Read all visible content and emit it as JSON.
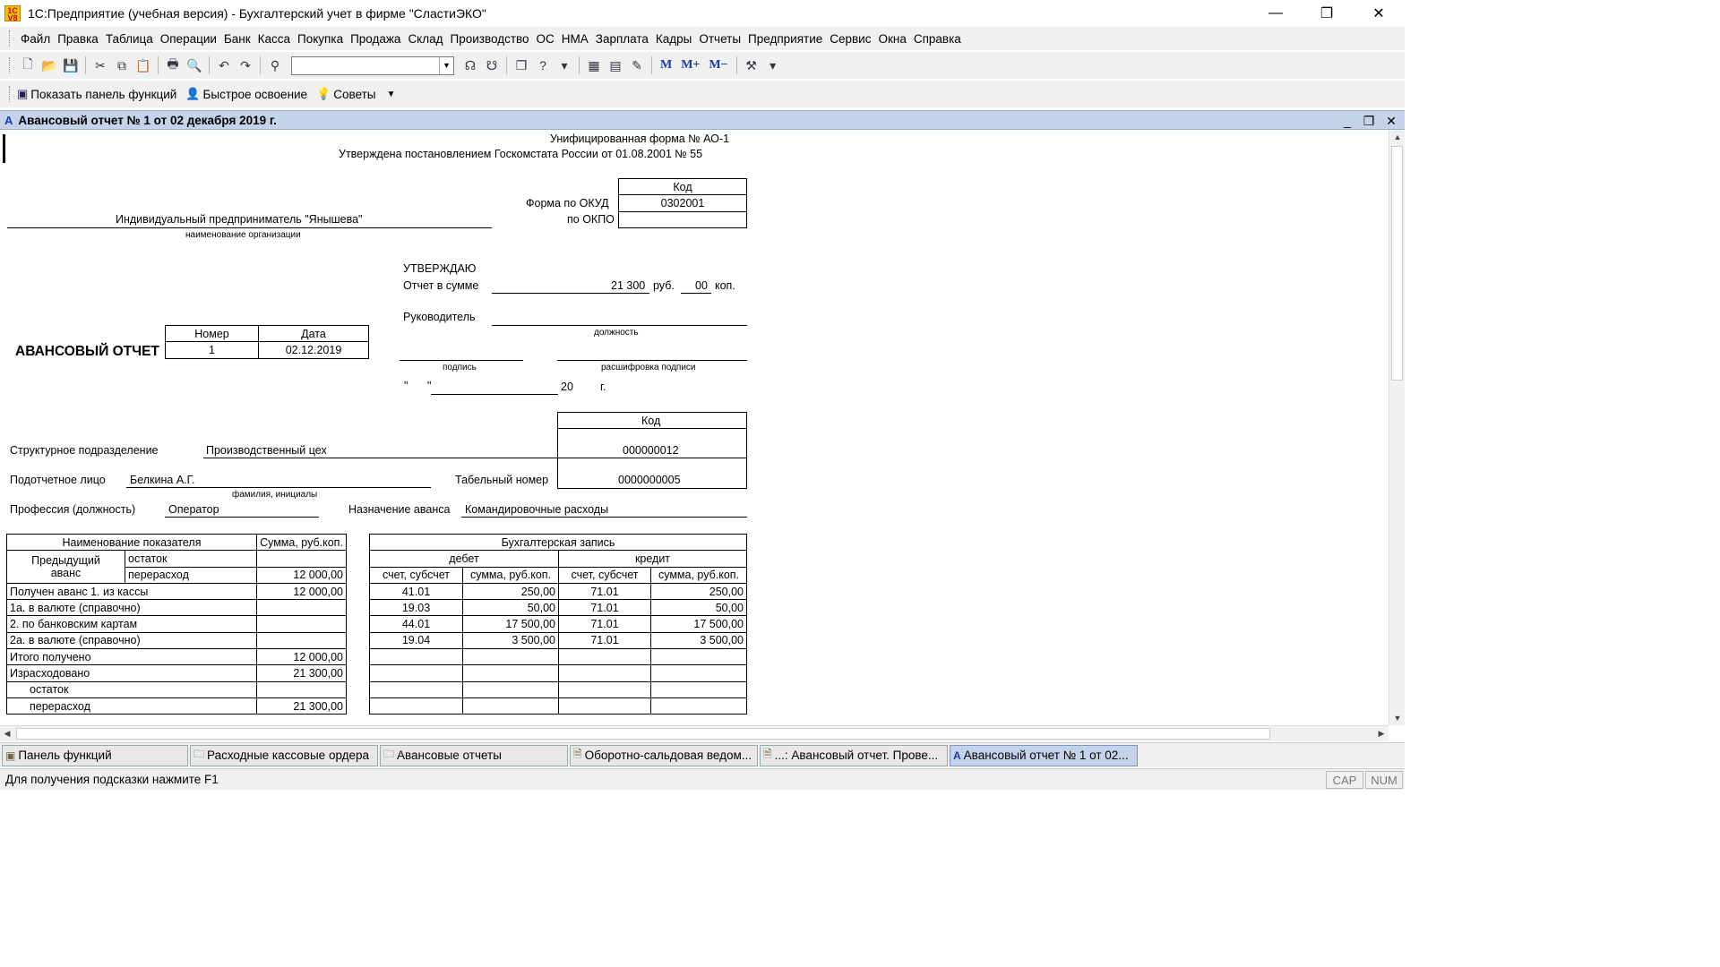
{
  "window": {
    "title": "1С:Предприятие (учебная версия) - Бухгалтерский учет в фирме \"СластиЭКО\"",
    "app_icon": "1C V8",
    "minimize": "—",
    "restore": "❐",
    "close": "✕"
  },
  "menu": [
    "Файл",
    "Правка",
    "Таблица",
    "Операции",
    "Банк",
    "Касса",
    "Покупка",
    "Продажа",
    "Склад",
    "Производство",
    "ОС",
    "НМА",
    "Зарплата",
    "Кадры",
    "Отчеты",
    "Предприятие",
    "Сервис",
    "Окна",
    "Справка"
  ],
  "toolbar": {
    "search_value": "",
    "m": "M",
    "mplus": "M+",
    "mminus": "M−"
  },
  "toolbar2": {
    "show_panel": "Показать панель функций",
    "quick_learn": "Быстрое освоение",
    "tips": "Советы"
  },
  "document": {
    "header": "Авансовый отчет № 1 от 02 декабря 2019 г.",
    "form_name": "Унифицированная форма № АО-1",
    "approved": "Утверждена постановлением Госкомстата России от  01.08.2001 № 55",
    "code_header": "Код",
    "okud_label": "Форма по ОКУД",
    "okud": "0302001",
    "okpo_label": "по ОКПО",
    "okpo": "",
    "org_name": "Индивидуальный предприниматель \"Янышева\"",
    "org_caption": "наименование организации",
    "approve": "УТВЕРЖДАЮ",
    "report_sum_label": "Отчет в сумме",
    "report_sum": "21 300",
    "rub": "руб.",
    "kop_value": "00",
    "kop": "коп.",
    "head_label": "Руководитель",
    "position_caption": "должность",
    "signature_caption": "подпись",
    "decrypt_caption": "расшифровка подписи",
    "quote_open": "\"",
    "quote_close": "\"",
    "year_prefix": "20",
    "year_suffix": "г.",
    "title": "АВАНСОВЫЙ ОТЧЕТ",
    "number_label": "Номер",
    "date_label": "Дата",
    "number": "1",
    "date": "02.12.2019",
    "code_header2": "Код",
    "dept_label": "Структурное подразделение",
    "dept": "Производственный цех",
    "dept_code": "000000012",
    "person_label": "Подотчетное лицо",
    "person": "Белкина А.Г.",
    "person_caption": "фамилия, инициалы",
    "tab_label": "Табельный номер",
    "tab_number": "0000000005",
    "profession_label": "Профессия (должность)",
    "profession": "Оператор",
    "purpose_label": "Назначение аванса",
    "purpose": "Командировочные расходы"
  },
  "left_table": {
    "h_name": "Наименование показателя",
    "h_sum": "Сумма, руб.коп.",
    "prev": "Предыдущий",
    "advance": "аванс",
    "rest": "остаток",
    "overspend": "перерасход",
    "overspend_sum": "12 000,00",
    "rows": [
      {
        "label": "Получен аванс 1. из кассы",
        "sum": "12 000,00"
      },
      {
        "label": "1а. в валюте (справочно)",
        "sum": ""
      },
      {
        "label": "2. по банковским картам",
        "sum": ""
      },
      {
        "label": "2а. в валюте (справочно)",
        "sum": ""
      },
      {
        "label": "Итого получено",
        "sum": "12 000,00"
      },
      {
        "label": "Израсходовано",
        "sum": "21 300,00"
      },
      {
        "label": "остаток",
        "sum": ""
      },
      {
        "label": "перерасход",
        "sum": "21 300,00"
      }
    ]
  },
  "right_table": {
    "h_entry": "Бухгалтерская запись",
    "debit": "дебет",
    "credit": "кредит",
    "h_acc": "счет, субсчет",
    "h_sum": "сумма, руб.коп.",
    "rows": [
      {
        "d_acc": "41.01",
        "d_sum": "250,00",
        "c_acc": "71.01",
        "c_sum": "250,00"
      },
      {
        "d_acc": "19.03",
        "d_sum": "50,00",
        "c_acc": "71.01",
        "c_sum": "50,00"
      },
      {
        "d_acc": "44.01",
        "d_sum": "17 500,00",
        "c_acc": "71.01",
        "c_sum": "17 500,00"
      },
      {
        "d_acc": "19.04",
        "d_sum": "3 500,00",
        "c_acc": "71.01",
        "c_sum": "3 500,00"
      },
      {
        "d_acc": "",
        "d_sum": "",
        "c_acc": "",
        "c_sum": ""
      },
      {
        "d_acc": "",
        "d_sum": "",
        "c_acc": "",
        "c_sum": ""
      },
      {
        "d_acc": "",
        "d_sum": "",
        "c_acc": "",
        "c_sum": ""
      },
      {
        "d_acc": "",
        "d_sum": "",
        "c_acc": "",
        "c_sum": ""
      }
    ]
  },
  "tasks": [
    {
      "label": "Панель функций",
      "icon": "panel-icon"
    },
    {
      "label": "Расходные кассовые ордера",
      "icon": "folder-icon"
    },
    {
      "label": "Авансовые отчеты",
      "icon": "folder-icon"
    },
    {
      "label": "Оборотно-сальдовая ведом...",
      "icon": "report-icon"
    },
    {
      "label": "...: Авансовый отчет. Прове...",
      "icon": "report-icon"
    },
    {
      "label": "Авансовый отчет № 1 от 02...",
      "icon": "document-icon"
    }
  ],
  "status": {
    "hint": "Для получения подсказки нажмите F1",
    "cap": "CAP",
    "num": "NUM"
  }
}
